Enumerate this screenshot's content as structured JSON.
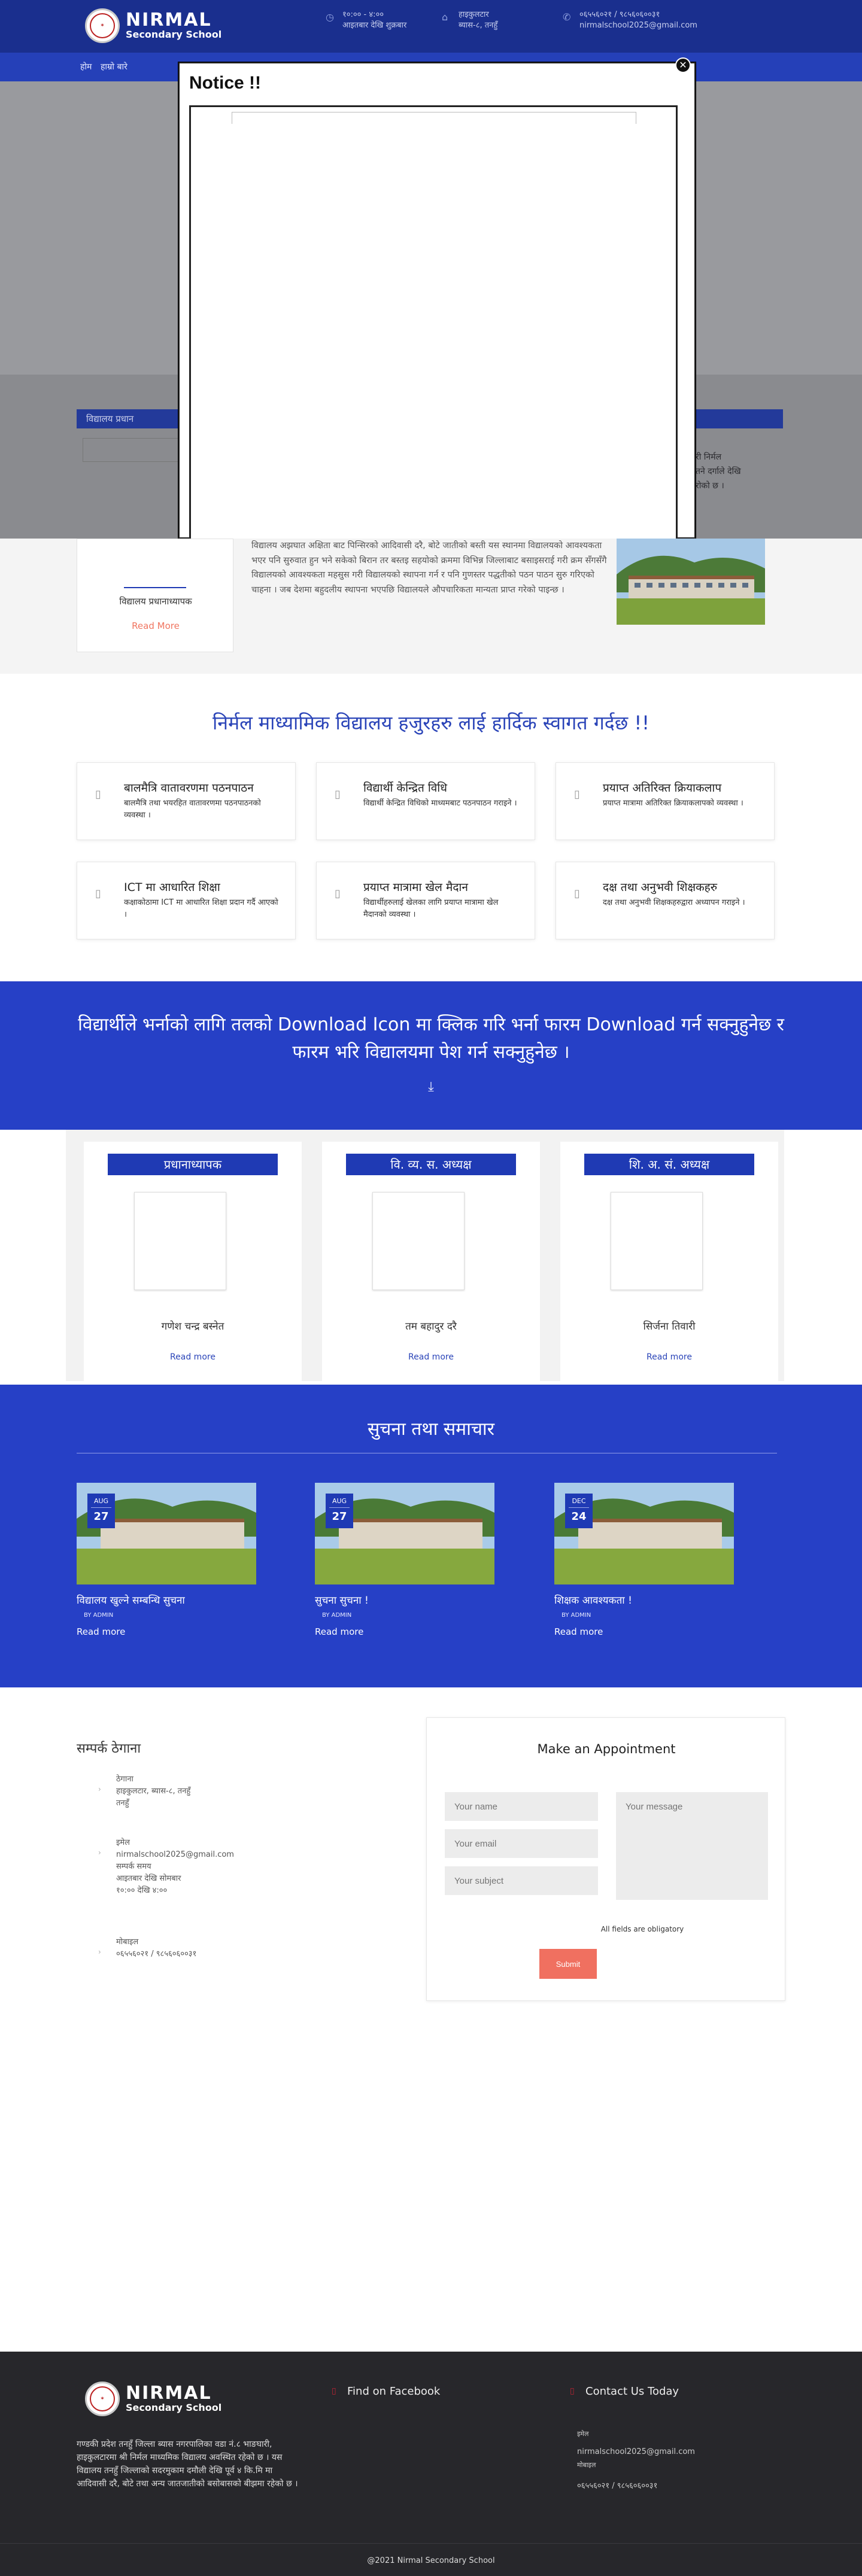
{
  "header": {
    "logo_name": "NIRMAL",
    "logo_sub": "Secondary School",
    "hours": "१०:०० - ४:००",
    "days": "आइतबार देखि शुक्रबार",
    "address1": "हाइकुलटार",
    "address2": "ब्यास-८, तनहुँ",
    "phone": "०६५५६०२१ / ९८५६०६००३१",
    "email": "nirmalschool2025@gmail.com"
  },
  "nav": {
    "items": [
      "होम",
      "हाम्रो बारे"
    ]
  },
  "notice": {
    "title": "Notice !!",
    "close_glyph": "✕"
  },
  "dimmed": {
    "bar_left": "विद्यालय प्रधान",
    "right_text1": "री निर्मल",
    "right_text2": "तने दर्गाले देखि",
    "right_text3": "रोको छ ।"
  },
  "principal": {
    "name": "विद्यालय प्रधानाध्यापक",
    "read_more": "Read More",
    "text": "विद्यालय अझघात अक्षिता बाट पिन्सिरको आदिवासी दरै, बोटे जातीको बस्ती यस स्थानमा विद्यालयको आवश्यकता भएर पनि सुरुवात हुन भने सकेको बिरान तर बस्तइ सहयोको क्रममा विभिन्न जिल्लाबाट बसाइसराई गरी क्रम सँगसँगै विद्यालयको आवश्यकता महसुस गरी विद्यालयको स्थापना गर्न र पनि गुणस्तर पद्धतीको पठन पाठन सुरु गरिएको चाहना । जब देशमा बहुदलीय स्थापना भएपछि विद्यालयले औपचारिकता मान्यता प्राप्त गरेको पाइन्छ ।"
  },
  "welcome": {
    "title": "निर्मल माध्यामिक विद्यालय हजुरहरु लाई हार्दिक स्वागत गर्दछ !!",
    "features": [
      {
        "title": "बालमैत्रि वातावरणमा पठनपाठन",
        "desc": "बालमैत्रि तथा भयरहित वातावरणमा पठनपाठनको व्यवस्था ।",
        "icon": "ribbon-icon"
      },
      {
        "title": "विद्यार्थी केन्द्रित विधि",
        "desc": "विद्यार्थी केन्द्रित विधिको माध्यमबाट पठनपाठन गराइने ।",
        "icon": "users-icon"
      },
      {
        "title": "प्रयाप्त अतिरिक्त क्रियाकलाप",
        "desc": "प्रयाप्त मात्रामा अतिरिक्त क्रियाकलापको व्यवस्था ।",
        "icon": "star-icon"
      },
      {
        "title": "ICT मा आधारित शिक्षा",
        "desc": "कक्षाकोठामा ICT मा आधारित शिक्षा प्रदान गर्दै आएको ।",
        "icon": "computer-icon"
      },
      {
        "title": "प्रयाप्त मात्रामा खेल मैदान",
        "desc": "विद्यार्थीहरुलाई खेलका लागि प्रयाप्त मात्रामा खेल मैदानको व्यवस्था ।",
        "icon": "ball-icon"
      },
      {
        "title": "दक्ष तथा अनुभवी शिक्षकहरु",
        "desc": "दक्ष तथा अनुभवी शिक्षकहरुद्वारा अध्यापन गराइने ।",
        "icon": "teacher-icon"
      }
    ]
  },
  "download": {
    "text": "विद्यार्थीले भर्नाको लागि तलको Download Icon मा क्लिक गरि भर्ना फारम Download गर्न सक्नुहुनेछ र फारम भरि विद्यालयमा पेश गर्न सक्नुहुनेछ ।",
    "icon_glyph": "⤓"
  },
  "committee": [
    {
      "role": "प्रधानाध्यापक",
      "name": "गणेश चन्द्र बस्नेत",
      "read_more": "Read more"
    },
    {
      "role": "वि. व्य. स. अध्यक्ष",
      "name": "तम बहादुर दरै",
      "read_more": "Read more"
    },
    {
      "role": "शि. अ. सं. अध्यक्ष",
      "name": "सिर्जना तिवारी",
      "read_more": "Read more"
    }
  ],
  "news": {
    "title": "सुचना तथा समाचार",
    "items": [
      {
        "month": "AUG",
        "day": "27",
        "title": "विद्यालय खुल्ने सम्बन्धि सुचना",
        "by": "BY ADMIN",
        "read_more": "Read more"
      },
      {
        "month": "AUG",
        "day": "27",
        "title": "सुचना सुचना !",
        "by": "BY ADMIN",
        "read_more": "Read more"
      },
      {
        "month": "DEC",
        "day": "24",
        "title": "शिक्षक आवश्यकता !",
        "by": "BY ADMIN",
        "read_more": "Read more"
      }
    ]
  },
  "contact": {
    "title": "सम्पर्क ठेगाना",
    "address_label": "ठेगाना",
    "address_value1": "हाइकुलटार, ब्यास-८, तनहुँ",
    "address_value2": "तनहुँ",
    "email_label": "इमेल",
    "email_value": "nirmalschool2025@gmail.com",
    "time_label": "सम्पर्क समय",
    "time_value1": "आइतबार देखि सोमबार",
    "time_value2": "१०:०० देखि ४:००",
    "phone_label": "मोबाइल",
    "phone_value": "०६५५६०२१ / ९८५६०६००३१"
  },
  "appointment": {
    "title": "Make an Appointment",
    "name_placeholder": "Your name",
    "email_placeholder": "Your email",
    "subject_placeholder": "Your subject",
    "message_placeholder": "Your message",
    "note": "All fields are obligatory",
    "submit": "Submit"
  },
  "footer": {
    "logo_name": "NIRMAL",
    "logo_sub": "Secondary School",
    "about": "गण्डकी प्रदेश तनहुँ जिल्ला ब्यास नगरपालिका वडा नं.८ भाङघारी, हाइकुलटारमा श्री निर्मल माध्यमिक विद्यालय अवस्थित रहेको छ । यस विद्यालय तनहुँ जिल्लाको सदरमुकाम दमौली देखि पूर्व ४ कि.मि मा आदिवासी दरै, बोटे तथा अन्य जातजातीको बसोबासको बीझमा रहेको छ ।",
    "fb_heading": "Find on Facebook",
    "contact_heading": "Contact Us Today",
    "email_label": "इमेल",
    "email_value": "nirmalschool2025@gmail.com",
    "phone_label": "मोबाइल",
    "phone_value": "०६५५६०२१ / ९८५६०६००३१",
    "copyright": "@2021 Nirmal Secondary School"
  },
  "colors": {
    "primary": "#2640c6",
    "dark_header": "#1a2f8e",
    "accent": "#f07060",
    "footer": "#27272b"
  }
}
